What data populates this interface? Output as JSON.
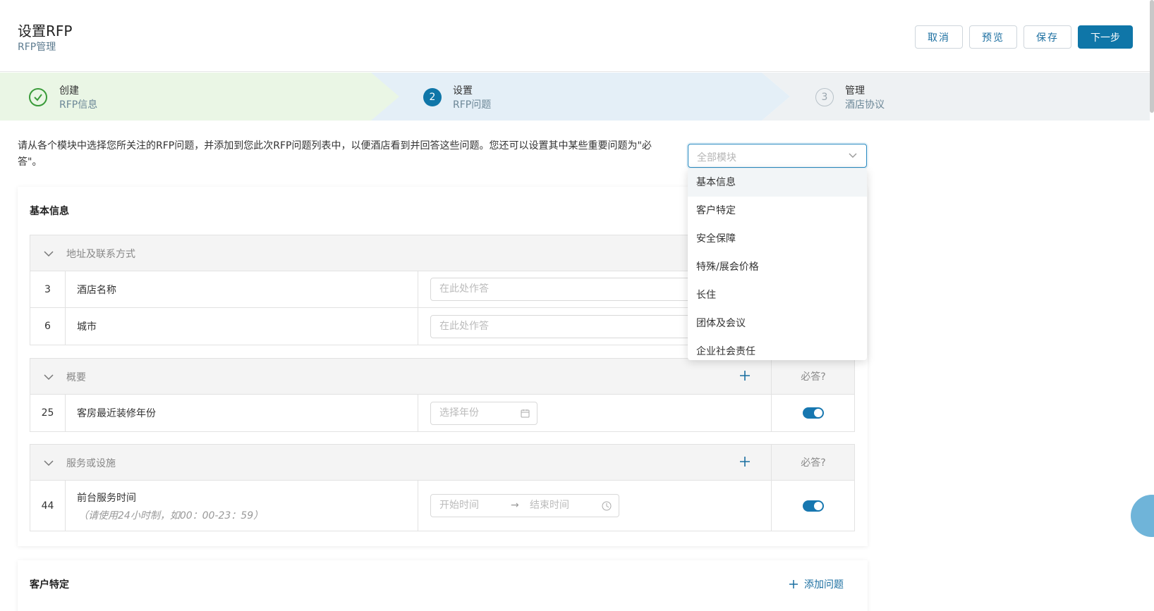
{
  "header": {
    "title": "设置RFP",
    "subtitle": "RFP管理",
    "buttons": {
      "cancel": "取消",
      "preview": "预览",
      "save": "保存",
      "next": "下一步"
    }
  },
  "steps": [
    {
      "number": "1",
      "title": "创建",
      "subtitle": "RFP信息",
      "state": "done"
    },
    {
      "number": "2",
      "title": "设置",
      "subtitle": "RFP问题",
      "state": "active"
    },
    {
      "number": "3",
      "title": "管理",
      "subtitle": "酒店协议",
      "state": "pending"
    }
  ],
  "description": "请从各个模块中选择您所关注的RFP问题，并添加到您此次RFP问题列表中，以便酒店看到并回答这些问题。您还可以设置其中某些重要问题为\"必答\"。",
  "module_select": {
    "placeholder": "全部模块",
    "options": [
      "基本信息",
      "客户特定",
      "安全保障",
      "特殊/展会价格",
      "长住",
      "团体及会议",
      "企业社会责任"
    ]
  },
  "section_basic": {
    "title": "基本信息",
    "groups": {
      "address": {
        "label": "地址及联系方式"
      },
      "overview": {
        "label": "概要",
        "required_header": "必答?"
      },
      "services": {
        "label": "服务或设施",
        "required_header": "必答?"
      }
    },
    "rows": {
      "hotel_name": {
        "no": "3",
        "question": "酒店名称",
        "placeholder": "在此处作答"
      },
      "city": {
        "no": "6",
        "question": "城市",
        "placeholder": "在此处作答"
      },
      "renovation": {
        "no": "25",
        "question": "客房最近装修年份",
        "placeholder": "选择年份",
        "required": true
      },
      "front_desk": {
        "no": "44",
        "question": "前台服务时间",
        "hint": "（请使用24小时制，如00：00-23：59）",
        "start_placeholder": "开始时间",
        "end_placeholder": "结束时间",
        "required": true
      }
    }
  },
  "section_client": {
    "title": "客户特定",
    "add_label": "添加问题"
  },
  "colors": {
    "primary": "#0f76a8",
    "step_done": "#eaf6e5",
    "step_active": "#e4eff7"
  }
}
